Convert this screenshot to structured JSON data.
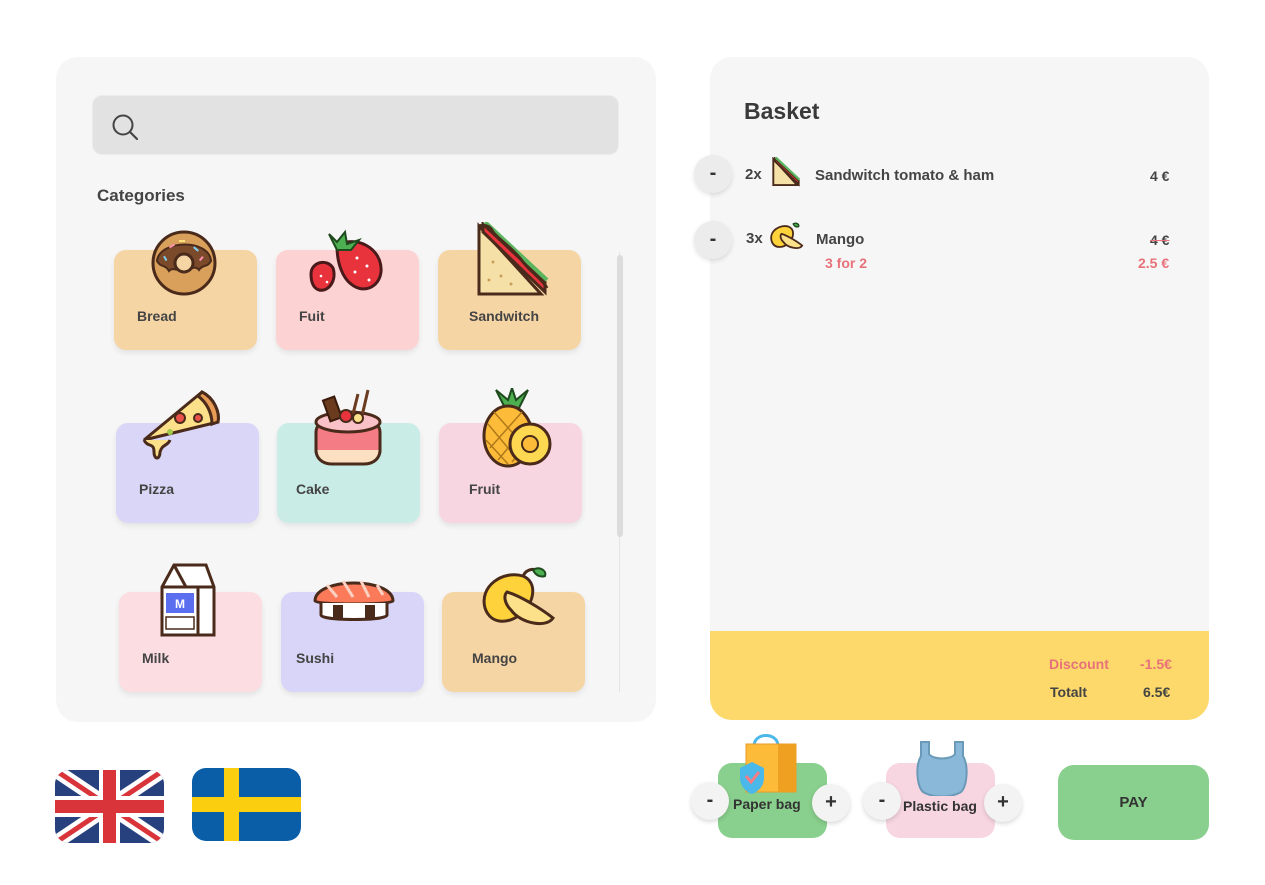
{
  "search": {
    "placeholder": "",
    "value": ""
  },
  "categories": {
    "title": "Categories",
    "items": [
      {
        "label": "Bread",
        "icon": "donut-icon",
        "color": "#f6d5a4"
      },
      {
        "label": "Fuit",
        "icon": "strawberry-icon",
        "color": "#fcd2d2"
      },
      {
        "label": "Sandwitch",
        "icon": "sandwich-icon",
        "color": "#f6d5a4"
      },
      {
        "label": "Pizza",
        "icon": "pizza-icon",
        "color": "#d9d6f7"
      },
      {
        "label": "Cake",
        "icon": "cake-icon",
        "color": "#c9ece6"
      },
      {
        "label": "Fruit",
        "icon": "pineapple-icon",
        "color": "#f7d6e1"
      },
      {
        "label": "Milk",
        "icon": "milk-carton-icon",
        "color": "#fcdde2"
      },
      {
        "label": "Sushi",
        "icon": "sushi-icon",
        "color": "#d8d5f8"
      },
      {
        "label": "Mango",
        "icon": "mango-icon",
        "color": "#f6d5a4"
      }
    ]
  },
  "languages": [
    {
      "name": "english",
      "icon": "uk-flag-icon"
    },
    {
      "name": "swedish",
      "icon": "sweden-flag-icon"
    }
  ],
  "basket": {
    "title": "Basket",
    "items": [
      {
        "qty": "2x",
        "name": "Sandwitch tomato & ham",
        "icon": "sandwich-icon",
        "price": "4 €"
      },
      {
        "qty": "3x",
        "name": "Mango",
        "icon": "mango-icon",
        "old_price": "4 €",
        "offer": "3 for 2",
        "price": "2.5 €"
      }
    ],
    "minus_label": "-",
    "discount_label": "Discount",
    "discount_value": "-1.5€",
    "total_label": "Totalt",
    "total_value": "6.5€"
  },
  "bags": [
    {
      "label": "Paper bag",
      "icon": "paper-bag-icon",
      "color": "#89cf8d"
    },
    {
      "label": "Plastic bag",
      "icon": "plastic-bag-icon",
      "color": "#f7d6e1"
    }
  ],
  "bag_controls": {
    "minus": "-",
    "plus": "+"
  },
  "pay_label": "PAY",
  "colors": {
    "accent_red": "#e8717a",
    "total_yellow": "#fcd96a",
    "pay_green": "#89cf8d"
  }
}
